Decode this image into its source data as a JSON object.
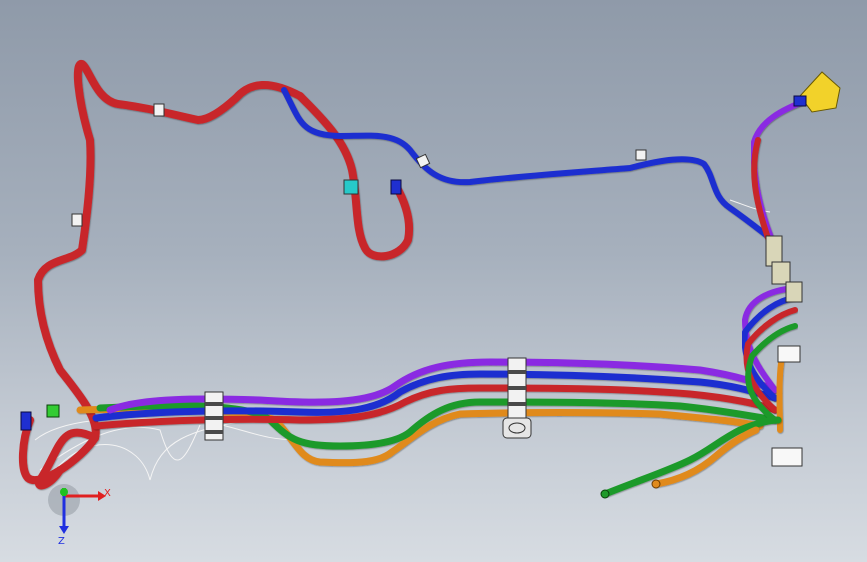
{
  "view": {
    "background_top": "#8f9aa9",
    "background_bottom": "#d7dce2"
  },
  "colors": {
    "red": "#c8282a",
    "blue": "#1f2fd0",
    "purple": "#8a2be2",
    "green": "#1f9a2a",
    "orange": "#e08a1c",
    "yellow": "#f2d22a",
    "cyan": "#27c9c9",
    "clamp_white": "#f2f2f2",
    "clamp_gray": "#4a4a4a"
  },
  "axis_triad": {
    "x_label": "X",
    "z_label": "Z",
    "x_color": "#e02020",
    "y_color": "#20c020",
    "z_color": "#2030e0"
  },
  "pipes": [
    {
      "name": "red-main-loop",
      "color": "red"
    },
    {
      "name": "blue-top-run",
      "color": "blue"
    },
    {
      "name": "purple-bundle-line",
      "color": "purple"
    },
    {
      "name": "blue-bundle-line",
      "color": "blue"
    },
    {
      "name": "red-bundle-line",
      "color": "red"
    },
    {
      "name": "green-bundle-line",
      "color": "green"
    },
    {
      "name": "orange-bundle-line",
      "color": "orange"
    }
  ]
}
